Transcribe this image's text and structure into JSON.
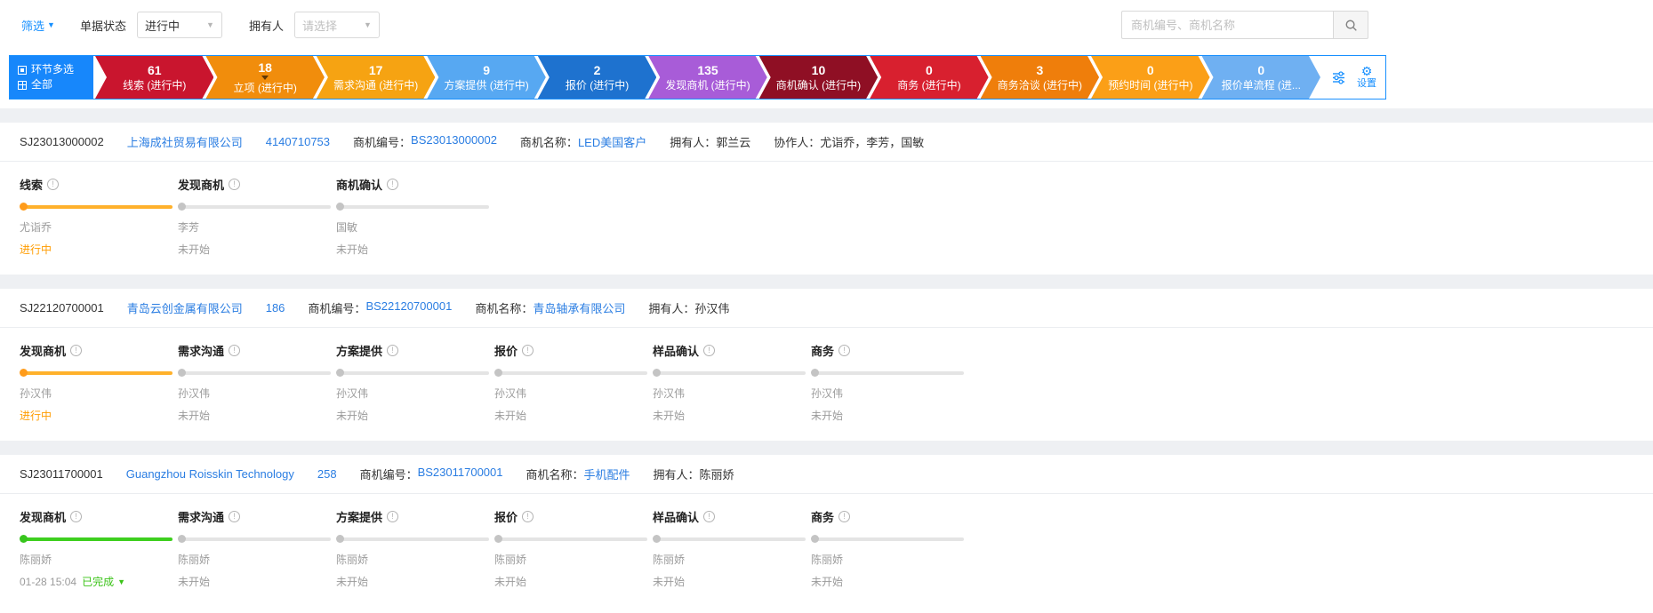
{
  "filter_bar": {
    "filter_label": "筛选",
    "doc_status_label": "单据状态",
    "doc_status_value": "进行中",
    "owner_label": "拥有人",
    "owner_placeholder": "请选择",
    "search_placeholder": "商机编号、商机名称"
  },
  "pipeline": {
    "multi_select_label": "环节多选",
    "all_label": "全部",
    "settings_label": "设置",
    "stages": [
      {
        "count": "61",
        "label": "线索 (进行中)",
        "color": "#c9152e",
        "selected": false
      },
      {
        "count": "18",
        "label": "立项 (进行中)",
        "color": "#f18d0c",
        "selected": true
      },
      {
        "count": "17",
        "label": "需求沟通 (进行中)",
        "color": "#f6a312",
        "selected": false
      },
      {
        "count": "9",
        "label": "方案提供 (进行中)",
        "color": "#57a8f2",
        "selected": false
      },
      {
        "count": "2",
        "label": "报价 (进行中)",
        "color": "#1e72cf",
        "selected": false
      },
      {
        "count": "135",
        "label": "发现商机 (进行中)",
        "color": "#a85cd8",
        "selected": false
      },
      {
        "count": "10",
        "label": "商机确认 (进行中)",
        "color": "#8f0f24",
        "selected": false
      },
      {
        "count": "0",
        "label": "商务 (进行中)",
        "color": "#d8202f",
        "selected": false
      },
      {
        "count": "3",
        "label": "商务洽谈 (进行中)",
        "color": "#ef7e0b",
        "selected": false
      },
      {
        "count": "0",
        "label": "预约时间 (进行中)",
        "color": "#fb9f17",
        "selected": false
      },
      {
        "count": "0",
        "label": "报价单流程 (进...",
        "color": "#6fb0f2",
        "selected": false
      }
    ]
  },
  "labels": {
    "bs_no": "商机编号：",
    "name": "商机名称：",
    "owner": "拥有人：",
    "collab": "协作人："
  },
  "records": [
    {
      "id": "SJ23013000002",
      "company": "上海成社贸易有限公司",
      "code": "4140710753",
      "bs_no": "BS23013000002",
      "name": "LED美国客户",
      "owner": "郭兰云",
      "collaborators": "尤诣乔，李芳，国敏",
      "stages": [
        {
          "title": "线索",
          "person": "尤诣乔",
          "state": "active",
          "status": "进行中"
        },
        {
          "title": "发现商机",
          "person": "李芳",
          "state": "pending",
          "status": "未开始"
        },
        {
          "title": "商机确认",
          "person": "国敏",
          "state": "pending",
          "status": "未开始"
        }
      ]
    },
    {
      "id": "SJ22120700001",
      "company": "青岛云创金属有限公司",
      "code": "186",
      "bs_no": "BS22120700001",
      "name": "青岛轴承有限公司",
      "owner": "孙汉伟",
      "collaborators": "",
      "stages": [
        {
          "title": "发现商机",
          "person": "孙汉伟",
          "state": "active",
          "status": "进行中"
        },
        {
          "title": "需求沟通",
          "person": "孙汉伟",
          "state": "pending",
          "status": "未开始"
        },
        {
          "title": "方案提供",
          "person": "孙汉伟",
          "state": "pending",
          "status": "未开始"
        },
        {
          "title": "报价",
          "person": "孙汉伟",
          "state": "pending",
          "status": "未开始"
        },
        {
          "title": "样品确认",
          "person": "孙汉伟",
          "state": "pending",
          "status": "未开始"
        },
        {
          "title": "商务",
          "person": "孙汉伟",
          "state": "pending",
          "status": "未开始"
        }
      ]
    },
    {
      "id": "SJ23011700001",
      "company": "Guangzhou Roisskin Technology",
      "code": "258",
      "bs_no": "BS23011700001",
      "name": "手机配件",
      "owner": "陈丽娇",
      "collaborators": "",
      "stages": [
        {
          "title": "发现商机",
          "person": "陈丽娇",
          "state": "done",
          "status": "已完成",
          "status_time": "01-28 15:04"
        },
        {
          "title": "需求沟通",
          "person": "陈丽娇",
          "state": "pending",
          "status": "未开始"
        },
        {
          "title": "方案提供",
          "person": "陈丽娇",
          "state": "pending",
          "status": "未开始"
        },
        {
          "title": "报价",
          "person": "陈丽娇",
          "state": "pending",
          "status": "未开始"
        },
        {
          "title": "样品确认",
          "person": "陈丽娇",
          "state": "pending",
          "status": "未开始"
        },
        {
          "title": "商务",
          "person": "陈丽娇",
          "state": "pending",
          "status": "未开始"
        }
      ]
    }
  ]
}
